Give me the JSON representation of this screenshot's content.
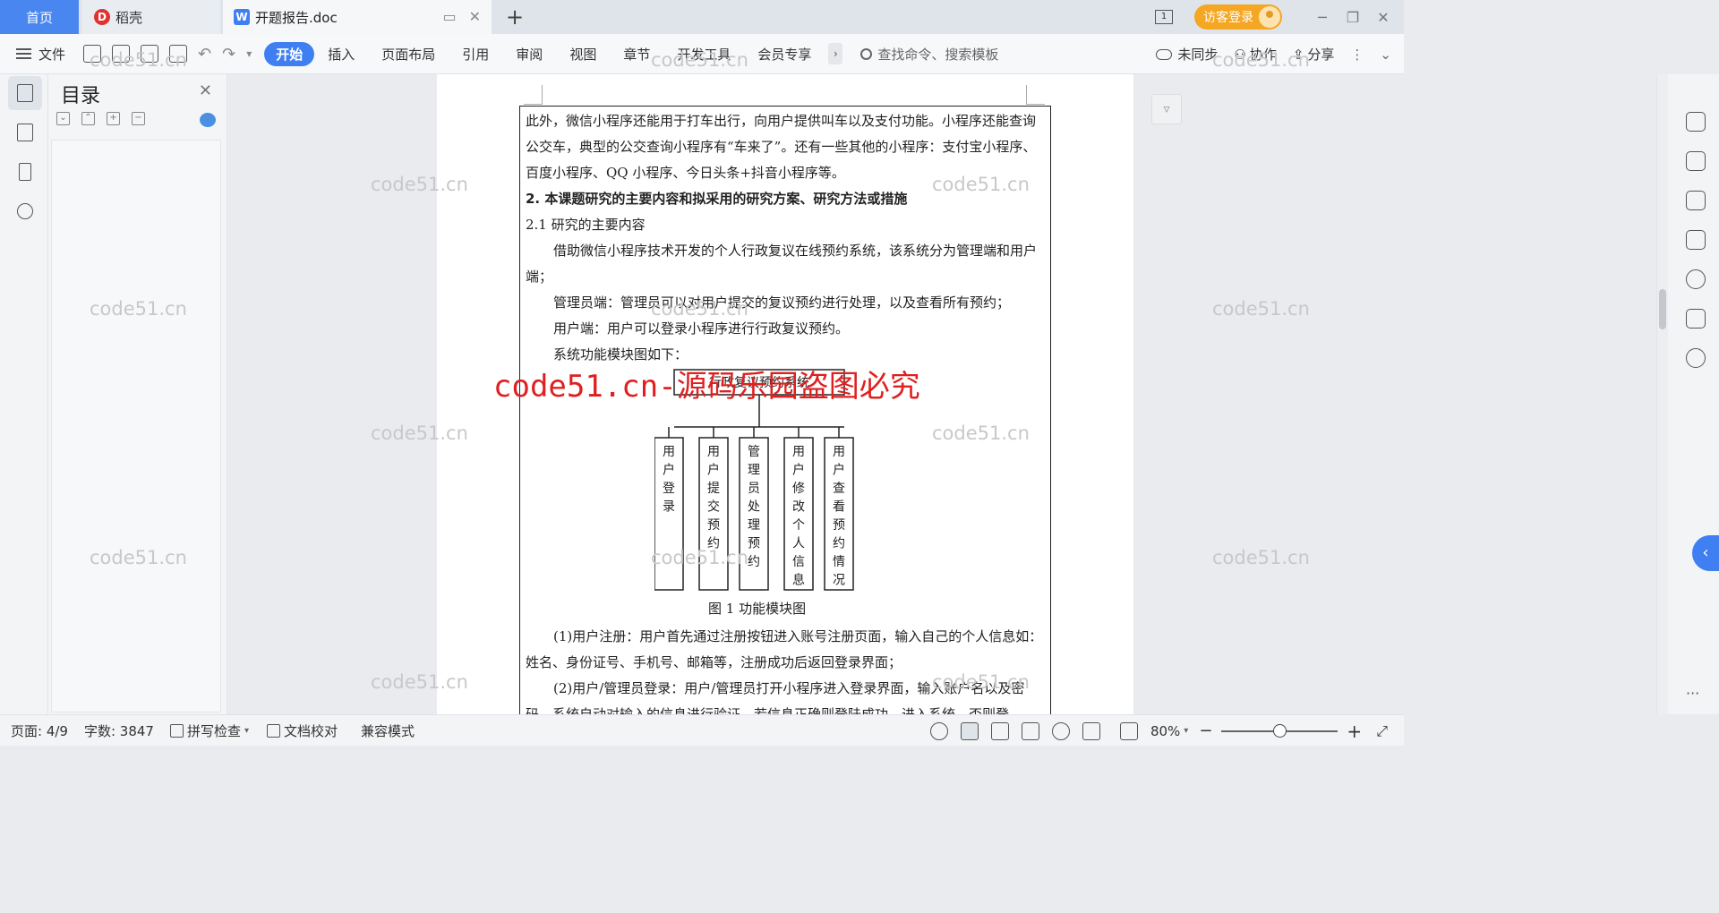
{
  "tabs": {
    "home": "首页",
    "daoke": "稻壳",
    "document": "开题报告.doc"
  },
  "topbar": {
    "visitor_login": "访客登录"
  },
  "toolbar": {
    "file_menu": "文件",
    "ribbon_tabs": [
      "开始",
      "插入",
      "页面布局",
      "引用",
      "审阅",
      "视图",
      "章节",
      "开发工具",
      "会员专享"
    ],
    "search_placeholder": "查找命令、搜索模板",
    "not_synced": "未同步",
    "collaborate": "协作",
    "share": "分享"
  },
  "toc": {
    "title": "目录"
  },
  "document": {
    "paragraphs": [
      "此外，微信小程序还能用于打车出行，向用户提供叫车以及支付功能。小程序还能查询公交车，典型的公交查询小程序有“车来了”。还有一些其他的小程序：支付宝小程序、百度小程序、QQ 小程序、今日头条+抖音小程序等。",
      "2. 本课题研究的主要内容和拟采用的研究方案、研究方法或措施",
      "2.1  研究的主要内容",
      "借助微信小程序技术开发的个人行政复议在线预约系统，该系统分为管理端和用户端；",
      "管理员端：管理员可以对用户提交的复议预约进行处理，以及查看所有预约；",
      "用户端：用户可以登录小程序进行行政复议预约。",
      "系统功能模块图如下：",
      "(1)用户注册：用户首先通过注册按钮进入账号注册页面，输入自己的个人信息如：姓名、身份证号、手机号、邮箱等，注册成功后返回登录界面；",
      "(2)用户/管理员登录：用户/管理员打开小程序进入登录界面，输入账户名以及密码，系统自动对输入的信息进行验证，若信息正确则登陆成功，进入系统，否则登"
    ],
    "diagram": {
      "root": "行政复议预约系统",
      "modules": [
        "用户登录",
        "用户提交预约",
        "管理员处理预约",
        "用户修改个人信息",
        "用户查看预约情况"
      ]
    },
    "figure_caption": "图 1 功能模块图"
  },
  "statusbar": {
    "page": "页面: 4/9",
    "word_count": "字数: 3847",
    "spell_check": "拼写检查",
    "doc_proof": "文档校对",
    "compat_mode": "兼容模式",
    "zoom": "80%"
  },
  "watermarks": {
    "small": "code51.cn",
    "banner": "code51.cn-源码乐园盗图必究"
  },
  "colors": {
    "accent": "#3f7ff2",
    "visitor": "#f5a623",
    "banner": "#e02020"
  }
}
